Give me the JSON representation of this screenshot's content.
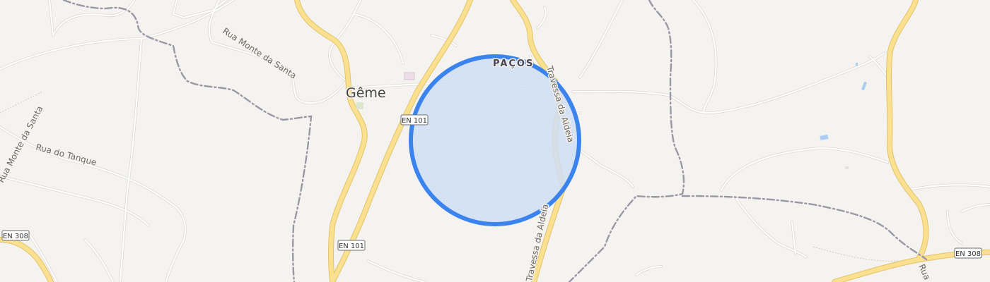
{
  "map": {
    "place": {
      "name": "Gême"
    },
    "locality": {
      "name": "PAÇOS"
    },
    "streets": [
      {
        "name": "Rua Monte da Santa"
      },
      {
        "name": "Rua Monte da Santa"
      },
      {
        "name": "Rua do Tanque"
      },
      {
        "name": "Travessa da Aldeia"
      },
      {
        "name": "Travessa da Aldeia"
      },
      {
        "name": "Rua"
      }
    ],
    "road_shields": [
      {
        "ref": "EN 101"
      },
      {
        "ref": "EN 101"
      },
      {
        "ref": "EN 308"
      },
      {
        "ref": "EN 308"
      }
    ],
    "accuracy_circle": {
      "fill": "#cfdef4",
      "stroke": "#3b84f0"
    },
    "colors": {
      "background": "#f5f3ef",
      "major_road": "#fbe08f",
      "minor_road": "#ffffff",
      "boundary": "#9a97a6",
      "water": "#a9cdf0"
    }
  }
}
